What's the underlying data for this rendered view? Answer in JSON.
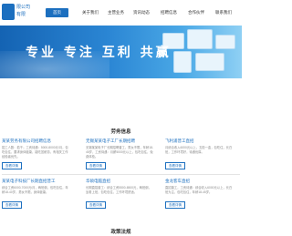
{
  "header": {
    "logo_line1": "限公司",
    "logo_line2": "有限",
    "nav": [
      "首页",
      "关于我们",
      "主营业务",
      "资讯动态",
      "招聘信息",
      "合作伙伴",
      "联系我们"
    ]
  },
  "banner": {
    "slogan": "专业  专注  互利  共赢"
  },
  "jobs": {
    "title": "劳务信息",
    "cards": [
      {
        "title": "某某劳务有限公司招聘信息",
        "text": "招工人数：若干；工资待遇：5000-8000元/月，包吃包住，要求身体健康，能吃苦耐劳，有相关工作经验者优先。",
        "btn": "查看详情"
      },
      {
        "title": "无锡某某电子工厂长期招聘",
        "text": "无锡某某电子厂长期招聘普工，男女不限，年龄18-45岁，工资待遇：月薪5000元以上，包吃包住，免费体检。",
        "btn": "查看详情"
      },
      {
        "title": "飞利浦普工直招",
        "text": "月综合收入6000元以上，五险一金，包吃住，长白班，工作环境好，待遇优厚。",
        "btn": "查看详情"
      },
      {
        "title": "某某电子科技厂长期直招普工",
        "text": "综合工资6000-7000元/月，两班倒，包吃包住，年龄18-40岁，男女不限，身体健康。",
        "btn": "查看详情"
      },
      {
        "title": "华硕电脑直招",
        "text": "长期直招普工：综合工资5500-6500元，两班倒，坐着上班，包吃包住，工作环境舒适。",
        "btn": "查看详情"
      },
      {
        "title": "金龙客车直招",
        "text": "直招普工，工资待遇：综合收入6000元以上，长白班为主，包吃包住，年龄18-45岁。",
        "btn": "查看详情"
      }
    ]
  },
  "policy": {
    "title": "政策法规"
  }
}
